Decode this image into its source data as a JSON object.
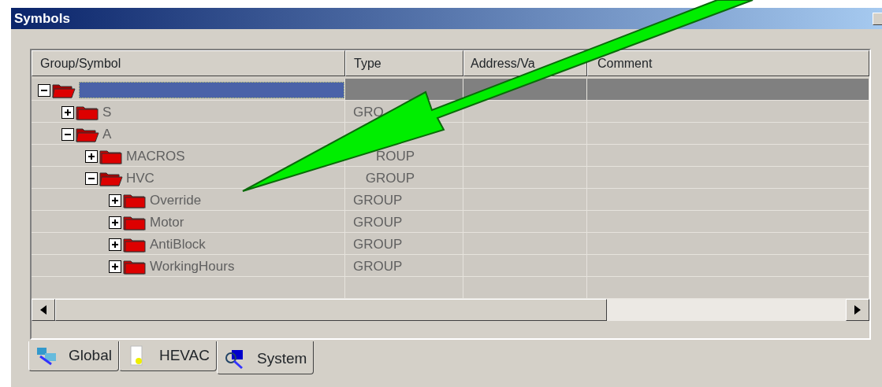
{
  "window": {
    "title": "Symbols"
  },
  "table": {
    "columns": [
      "Group/Symbol",
      "Type",
      "Address/Va",
      "Comment"
    ],
    "rows": [
      {
        "expanded": true,
        "selected": true,
        "children": [
          {
            "name": "S",
            "type": "GRO",
            "expanded": false,
            "selected": false
          },
          {
            "name": "A",
            "expanded": true,
            "selected": false,
            "children": [
              {
                "name": "MACROS",
                "type": "ROUP",
                "expanded": false,
                "selected": false
              },
              {
                "name": "HVC",
                "type": "GROUP",
                "expanded": true,
                "selected": false,
                "children": [
                  {
                    "name": "Override",
                    "type": "GROUP",
                    "expanded": false,
                    "selected": false
                  },
                  {
                    "name": "Motor",
                    "type": "GROUP",
                    "expanded": false,
                    "selected": false
                  },
                  {
                    "name": "AntiBlock",
                    "type": "GROUP",
                    "expanded": false,
                    "selected": false
                  },
                  {
                    "name": "WorkingHours",
                    "type": "GROUP",
                    "expanded": false,
                    "selected": false
                  }
                ]
              }
            ]
          }
        ]
      }
    ]
  },
  "tabs": [
    {
      "label": "Global",
      "selected": false
    },
    {
      "label": "HEVAC",
      "selected": false
    },
    {
      "label": "System",
      "selected": true
    }
  ]
}
